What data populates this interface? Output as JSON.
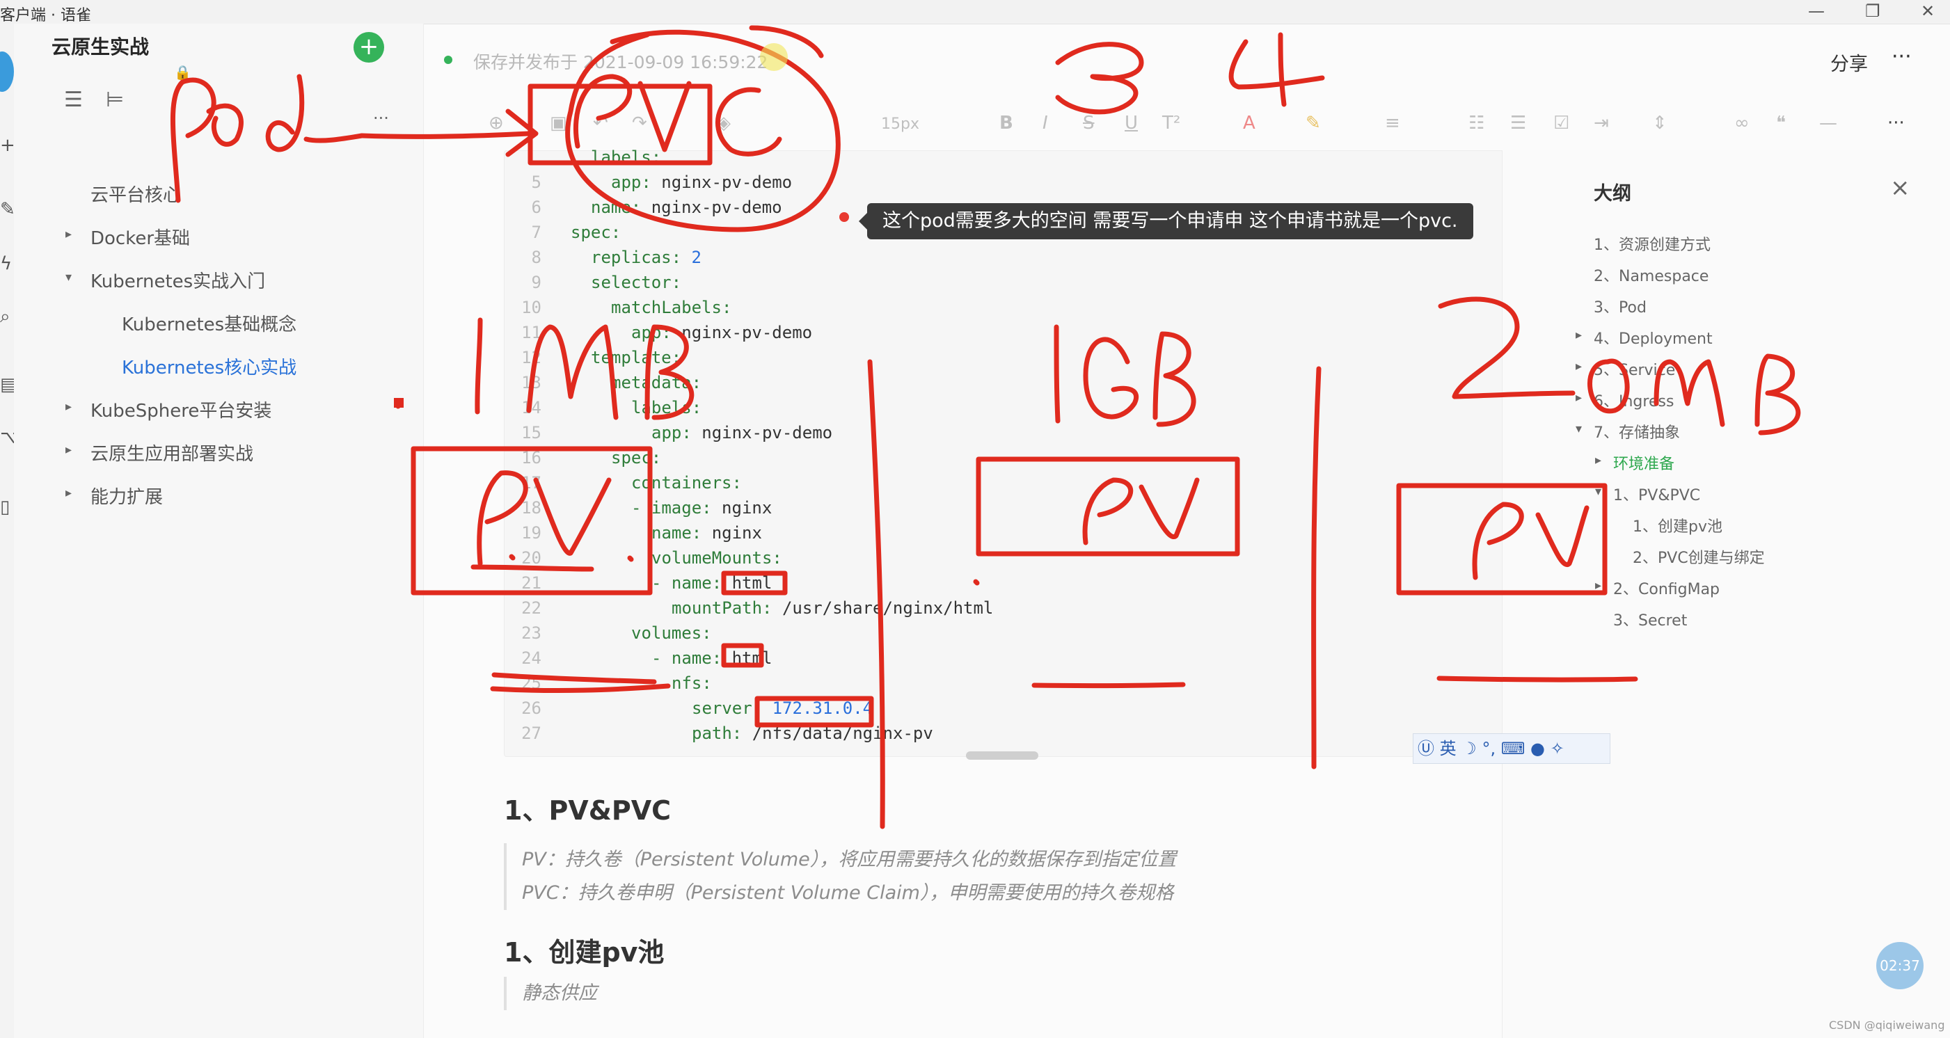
{
  "window": {
    "title": "客户端 · 语雀"
  },
  "sidebar": {
    "kb_title": "云原生实战",
    "items": [
      {
        "label": "云平台核心",
        "level": 0,
        "caret": ""
      },
      {
        "label": "Docker基础",
        "level": 0,
        "caret": "▸"
      },
      {
        "label": "Kubernetes实战入门",
        "level": 0,
        "caret": "▾"
      },
      {
        "label": "Kubernetes基础概念",
        "level": 1,
        "caret": ""
      },
      {
        "label": "Kubernetes核心实战",
        "level": 1,
        "caret": "",
        "active": true
      },
      {
        "label": "KubeSphere平台安装",
        "level": 0,
        "caret": "▸"
      },
      {
        "label": "云原生应用部署实战",
        "level": 0,
        "caret": "▸"
      },
      {
        "label": "能力扩展",
        "level": 0,
        "caret": "▸"
      }
    ]
  },
  "header": {
    "status": "保存并发布于 2021-09-09 16:59:22",
    "share": "分享",
    "more": "···"
  },
  "toolbar": {
    "font_size": "15px"
  },
  "code": {
    "lines": [
      {
        "n": "",
        "indent": 2,
        "key": "labels:",
        "val": ""
      },
      {
        "n": "5",
        "indent": 4,
        "key": "app:",
        "val": " nginx-pv-demo"
      },
      {
        "n": "6",
        "indent": 2,
        "key": "name:",
        "val": " nginx-pv-demo"
      },
      {
        "n": "7",
        "indent": 0,
        "key": "spec:",
        "val": ""
      },
      {
        "n": "8",
        "indent": 2,
        "key": "replicas:",
        "val": " 2",
        "num": true
      },
      {
        "n": "9",
        "indent": 2,
        "key": "selector:",
        "val": ""
      },
      {
        "n": "10",
        "indent": 4,
        "key": "matchLabels:",
        "val": ""
      },
      {
        "n": "11",
        "indent": 6,
        "key": "app:",
        "val": " nginx-pv-demo"
      },
      {
        "n": "12",
        "indent": 2,
        "key": "template:",
        "val": ""
      },
      {
        "n": "13",
        "indent": 4,
        "key": "metadata:",
        "val": ""
      },
      {
        "n": "14",
        "indent": 6,
        "key": "labels:",
        "val": ""
      },
      {
        "n": "15",
        "indent": 8,
        "key": "app:",
        "val": " nginx-pv-demo"
      },
      {
        "n": "16",
        "indent": 4,
        "key": "spec:",
        "val": ""
      },
      {
        "n": "17",
        "indent": 6,
        "key": "containers:",
        "val": ""
      },
      {
        "n": "18",
        "indent": 6,
        "key": "- image:",
        "val": " nginx"
      },
      {
        "n": "19",
        "indent": 8,
        "key": "name:",
        "val": " nginx"
      },
      {
        "n": "20",
        "indent": 8,
        "key": "volumeMounts:",
        "val": ""
      },
      {
        "n": "21",
        "indent": 8,
        "key": "- name:",
        "val": " html"
      },
      {
        "n": "22",
        "indent": 10,
        "key": "mountPath:",
        "val": " /usr/share/nginx/html"
      },
      {
        "n": "23",
        "indent": 6,
        "key": "volumes:",
        "val": ""
      },
      {
        "n": "24",
        "indent": 8,
        "key": "- name:",
        "val": " html"
      },
      {
        "n": "25",
        "indent": 10,
        "key": "nfs:",
        "val": ""
      },
      {
        "n": "26",
        "indent": 12,
        "key": "server:",
        "val": " 172.31.0.4",
        "num": true
      },
      {
        "n": "27",
        "indent": 12,
        "key": "path:",
        "val": " /nfs/data/nginx-pv"
      }
    ]
  },
  "tooltip": "这个pod需要多大的空间 需要写一个申请申 这个申请书就是一个pvc.",
  "document": {
    "h_pvpvc": "1、PV&PVC",
    "quote_pv": "PV：持久卷（Persistent Volume），将应用需要持久化的数据保存到指定位置",
    "quote_pvc": "PVC：持久卷申明（Persistent Volume Claim），申明需要使用的持久卷规格",
    "h_pool": "1、创建pv池",
    "quote_static": "静态供应"
  },
  "outline": {
    "title": "大纲",
    "items": [
      {
        "label": "1、资源创建方式",
        "x": 0
      },
      {
        "label": "2、Namespace",
        "x": 0
      },
      {
        "label": "3、Pod",
        "x": 0
      },
      {
        "label": "4、Deployment",
        "x": 0,
        "caret": "▸"
      },
      {
        "label": "5、Service",
        "x": 0,
        "caret": "▸"
      },
      {
        "label": "6、Ingress",
        "x": 0,
        "caret": "▸"
      },
      {
        "label": "7、存储抽象",
        "x": 0,
        "caret": "▾"
      },
      {
        "label": "环境准备",
        "x": 1,
        "caret": "▸",
        "active": true
      },
      {
        "label": "1、PV&PVC",
        "x": 1,
        "caret": "▾"
      },
      {
        "label": "1、创建pv池",
        "x": 2
      },
      {
        "label": "2、PVC创建与绑定",
        "x": 2
      },
      {
        "label": "2、ConfigMap",
        "x": 1,
        "caret": "▸"
      },
      {
        "label": "3、Secret",
        "x": 1
      }
    ]
  },
  "annotations": {
    "pod_arrow": "Pod→PVC",
    "num_3": "3",
    "num_4": "4",
    "size_1": "1MB",
    "size_2": "1GB",
    "size_3": "20MB",
    "pv": "PV"
  },
  "ime": "英",
  "timer": "02:37",
  "watermark": "CSDN @qiqiweiwang"
}
